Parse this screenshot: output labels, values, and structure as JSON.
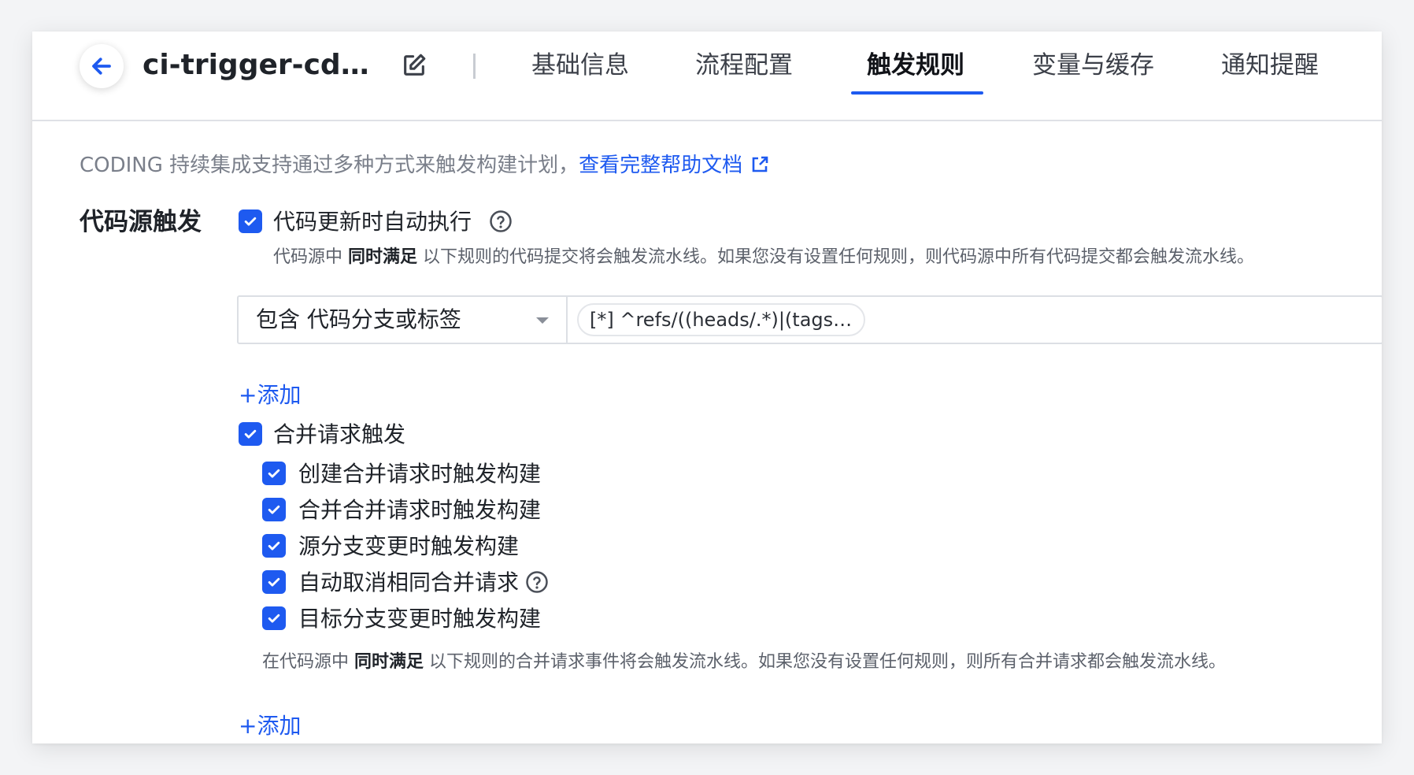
{
  "header": {
    "title": "ci-trigger-cd-trigger-pipeline",
    "tabs": [
      {
        "label": "基础信息",
        "active": false
      },
      {
        "label": "流程配置",
        "active": false
      },
      {
        "label": "触发规则",
        "active": true
      },
      {
        "label": "变量与缓存",
        "active": false
      },
      {
        "label": "通知提醒",
        "active": false
      }
    ]
  },
  "intro": {
    "text": "CODING 持续集成支持通过多种方式来触发构建计划，",
    "link_text": "查看完整帮助文档"
  },
  "code_trigger": {
    "section_label": "代码源触发",
    "auto_run": {
      "label": "代码更新时自动执行",
      "checked": true
    },
    "desc_prefix": "代码源中 ",
    "desc_bold": "同时满足",
    "desc_suffix": " 以下规则的代码提交将会触发流水线。如果您没有设置任何规则，则代码源中所有代码提交都会触发流水线。",
    "rule": {
      "selected": "包含 代码分支或标签",
      "value": "[*]  ^refs/((heads/.*)|(tags/...."
    },
    "add_label": "+添加"
  },
  "merge_request": {
    "label": "合并请求触发",
    "checked": true,
    "options": [
      {
        "label": "创建合并请求时触发构建",
        "checked": true
      },
      {
        "label": "合并合并请求时触发构建",
        "checked": true
      },
      {
        "label": "源分支变更时触发构建",
        "checked": true
      },
      {
        "label": "自动取消相同合并请求",
        "checked": true
      },
      {
        "label": "目标分支变更时触发构建",
        "checked": true
      }
    ],
    "desc_prefix": "在代码源中 ",
    "desc_bold": "同时满足",
    "desc_suffix": " 以下规则的合并请求事件将会触发流水线。如果您没有设置任何规则，则所有合并请求都会触发流水线。",
    "add_label": "+添加"
  },
  "colors": {
    "accent": "#1e5af0",
    "text": "#1f2329",
    "muted": "#7a7f8a"
  }
}
